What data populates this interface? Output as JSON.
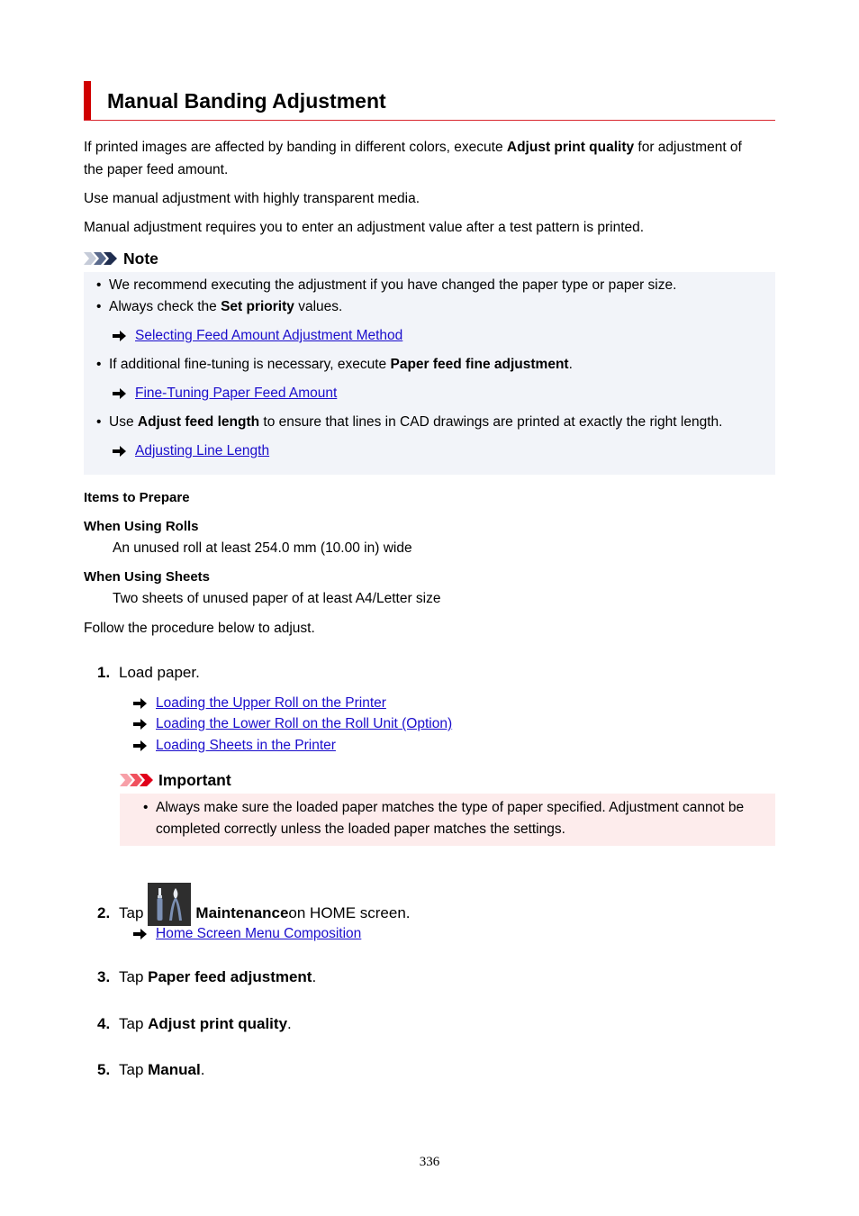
{
  "title": "Manual Banding Adjustment",
  "intro": {
    "p1_pre": "If printed images are affected by banding in different colors, execute ",
    "p1_bold": "Adjust print quality",
    "p1_post": " for adjustment of",
    "p1_line2": "the paper feed amount.",
    "p2": "Use manual adjustment with highly transparent media.",
    "p3": "Manual adjustment requires you to enter an adjustment value after a test pattern is printed."
  },
  "note": {
    "label": "Note",
    "b1": "We recommend executing the adjustment if you have changed the paper type or paper size.",
    "b2_pre": "Always check the ",
    "b2_bold": "Set priority",
    "b2_post": " values.",
    "link1": "Selecting Feed Amount Adjustment Method",
    "b3_pre": "If additional fine-tuning is necessary, execute ",
    "b3_bold": "Paper feed fine adjustment",
    "b3_post": ".",
    "link2": "Fine-Tuning Paper Feed Amount",
    "b4_pre": "Use ",
    "b4_bold": "Adjust feed length",
    "b4_post": " to ensure that lines in CAD drawings are printed at exactly the right length.",
    "link3": "Adjusting Line Length"
  },
  "prepare": {
    "heading": "Items to Prepare",
    "rolls_heading": "When Using Rolls",
    "rolls_text": "An unused roll at least 254.0 mm (10.00 in) wide",
    "sheets_heading": "When Using Sheets",
    "sheets_text": "Two sheets of unused paper of at least A4/Letter size",
    "follow": "Follow the procedure below to adjust."
  },
  "steps": {
    "s1_num": "1.",
    "s1_text": "Load paper.",
    "s1_links": [
      "Loading the Upper Roll on the Printer",
      "Loading the Lower Roll on the Roll Unit (Option)",
      "Loading Sheets in the Printer"
    ],
    "important_label": "Important",
    "important_line1": "Always make sure the loaded paper matches the type of paper specified. Adjustment cannot be",
    "important_line2": "completed correctly unless the loaded paper matches the settings.",
    "s2_num": "2.",
    "s2_pre": "Tap",
    "s2_bold": "Maintenance",
    "s2_post": " on HOME screen.",
    "s2_link": "Home Screen Menu Composition",
    "s3_num": "3.",
    "s3_pre": "Tap ",
    "s3_bold": "Paper feed adjustment",
    "s3_post": ".",
    "s4_num": "4.",
    "s4_pre": "Tap ",
    "s4_bold": "Adjust print quality",
    "s4_post": ".",
    "s5_num": "5.",
    "s5_pre": "Tap ",
    "s5_bold": "Manual",
    "s5_post": "."
  },
  "page_number": "336"
}
